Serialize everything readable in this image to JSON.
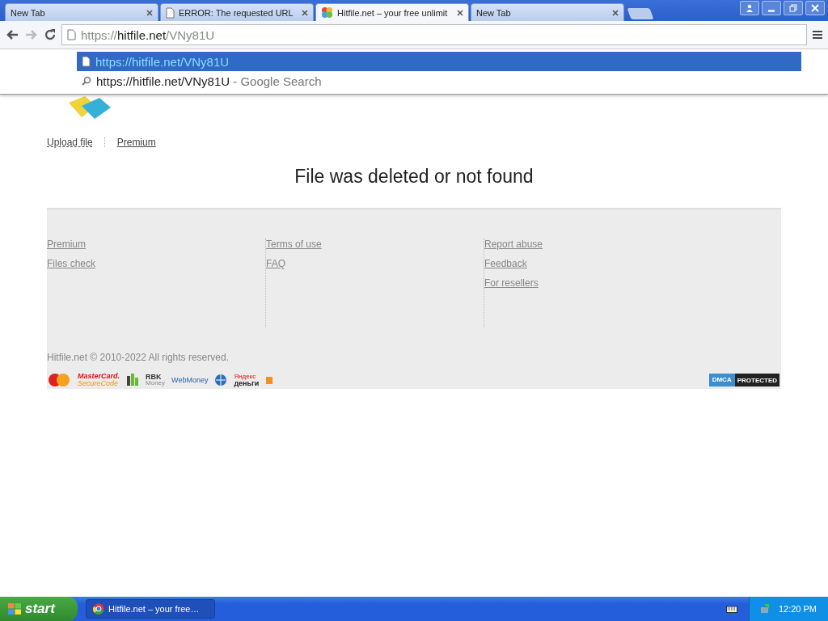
{
  "browser": {
    "tabs": [
      {
        "title": "New Tab",
        "kind": "blank",
        "selected": false
      },
      {
        "title": "ERROR: The requested URL",
        "kind": "document",
        "selected": false
      },
      {
        "title": "Hitfile.net – your free unlimit",
        "kind": "site",
        "selected": true
      },
      {
        "title": "New Tab",
        "kind": "blank",
        "selected": false
      }
    ],
    "address": {
      "scheme": "https://",
      "host": "hitfile.net",
      "path": "/VNy81U"
    },
    "suggestions": [
      {
        "kind": "url",
        "text": "https://hitfile.net/VNy81U",
        "selected": true
      },
      {
        "kind": "search",
        "text": "https://hitfile.net/VNy81U",
        "suffix": " - Google Search",
        "selected": false
      }
    ]
  },
  "page": {
    "nav": [
      "Upload file",
      "Premium"
    ],
    "message": "File was deleted or not found",
    "footer_columns": [
      [
        "Premium",
        "Files check"
      ],
      [
        "Terms of use",
        "FAQ"
      ],
      [
        "Report abuse",
        "Feedback",
        "For resellers"
      ]
    ],
    "copyright": "Hitfile.net © 2010-2022 All rights reserved.",
    "payments": {
      "mastercard": [
        "MasterCard.",
        "SecureCode"
      ],
      "rbk": [
        "RBK",
        "Money"
      ],
      "webmoney": "WebMoney",
      "yandex": [
        "Яндекс",
        "деньги"
      ]
    },
    "dmca": [
      "DMCA",
      "PROTECTED"
    ]
  },
  "taskbar": {
    "start": "start",
    "windows": [
      {
        "title": "Hitfile.net – your free…",
        "selected": false
      }
    ],
    "clock": "12:20 PM"
  }
}
